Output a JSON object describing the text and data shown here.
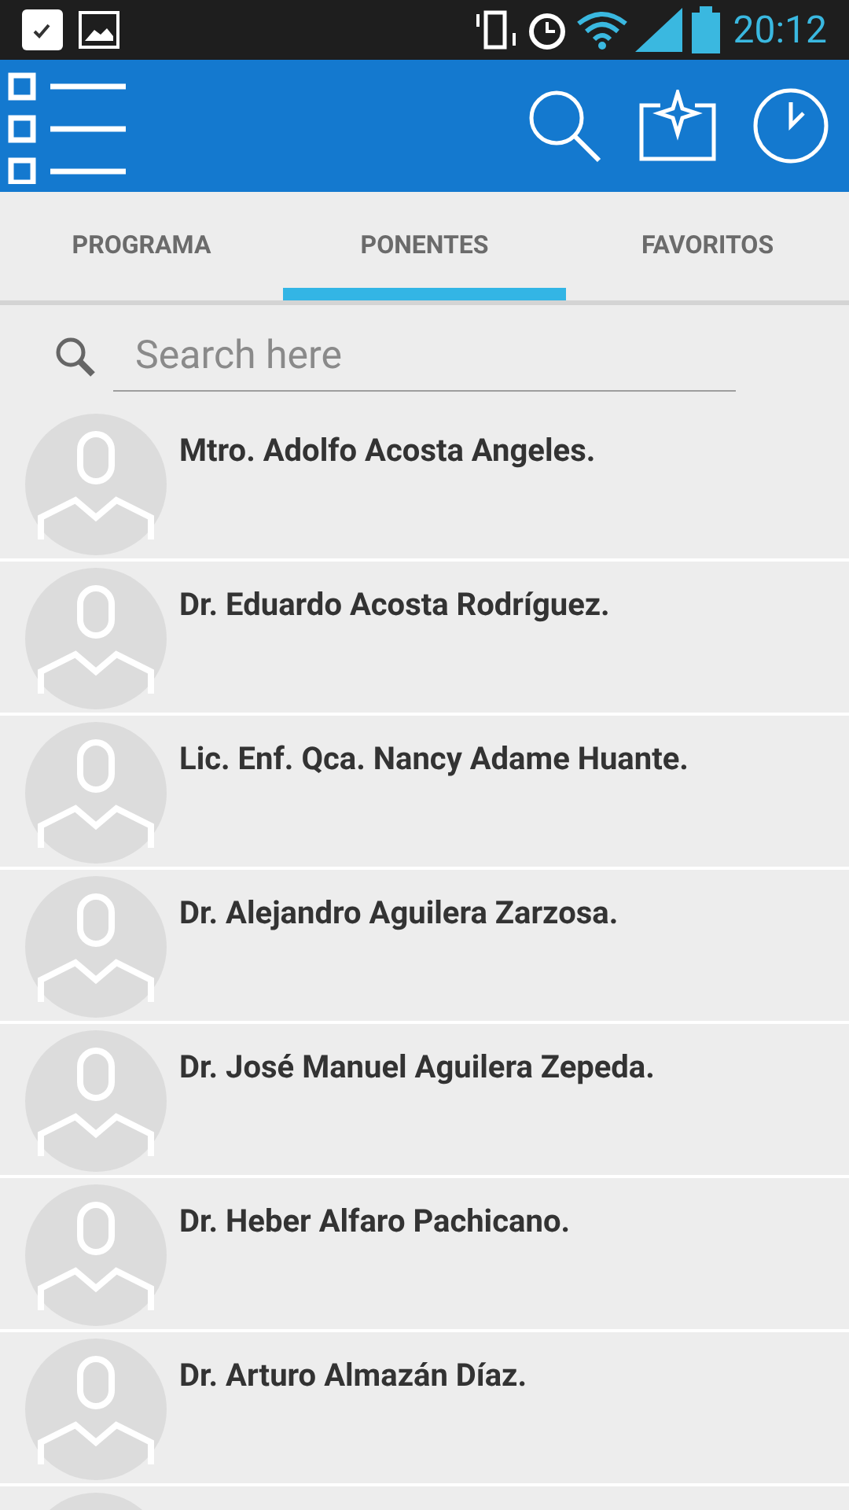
{
  "status_bar": {
    "time": "20:12"
  },
  "tabs": [
    {
      "label": "PROGRAMA",
      "selected": false
    },
    {
      "label": "PONENTES",
      "selected": true
    },
    {
      "label": "FAVORITOS",
      "selected": false
    }
  ],
  "search": {
    "placeholder": "Search here"
  },
  "speakers": [
    {
      "name": "Mtro. Adolfo Acosta Angeles."
    },
    {
      "name": "Dr. Eduardo Acosta Rodríguez."
    },
    {
      "name": "Lic. Enf. Qca. Nancy Adame Huante."
    },
    {
      "name": "Dr. Alejandro Aguilera Zarzosa."
    },
    {
      "name": "Dr. José Manuel Aguilera Zepeda."
    },
    {
      "name": "Dr. Heber Alfaro Pachicano."
    },
    {
      "name": "Dr. Arturo Almazán Díaz."
    }
  ]
}
